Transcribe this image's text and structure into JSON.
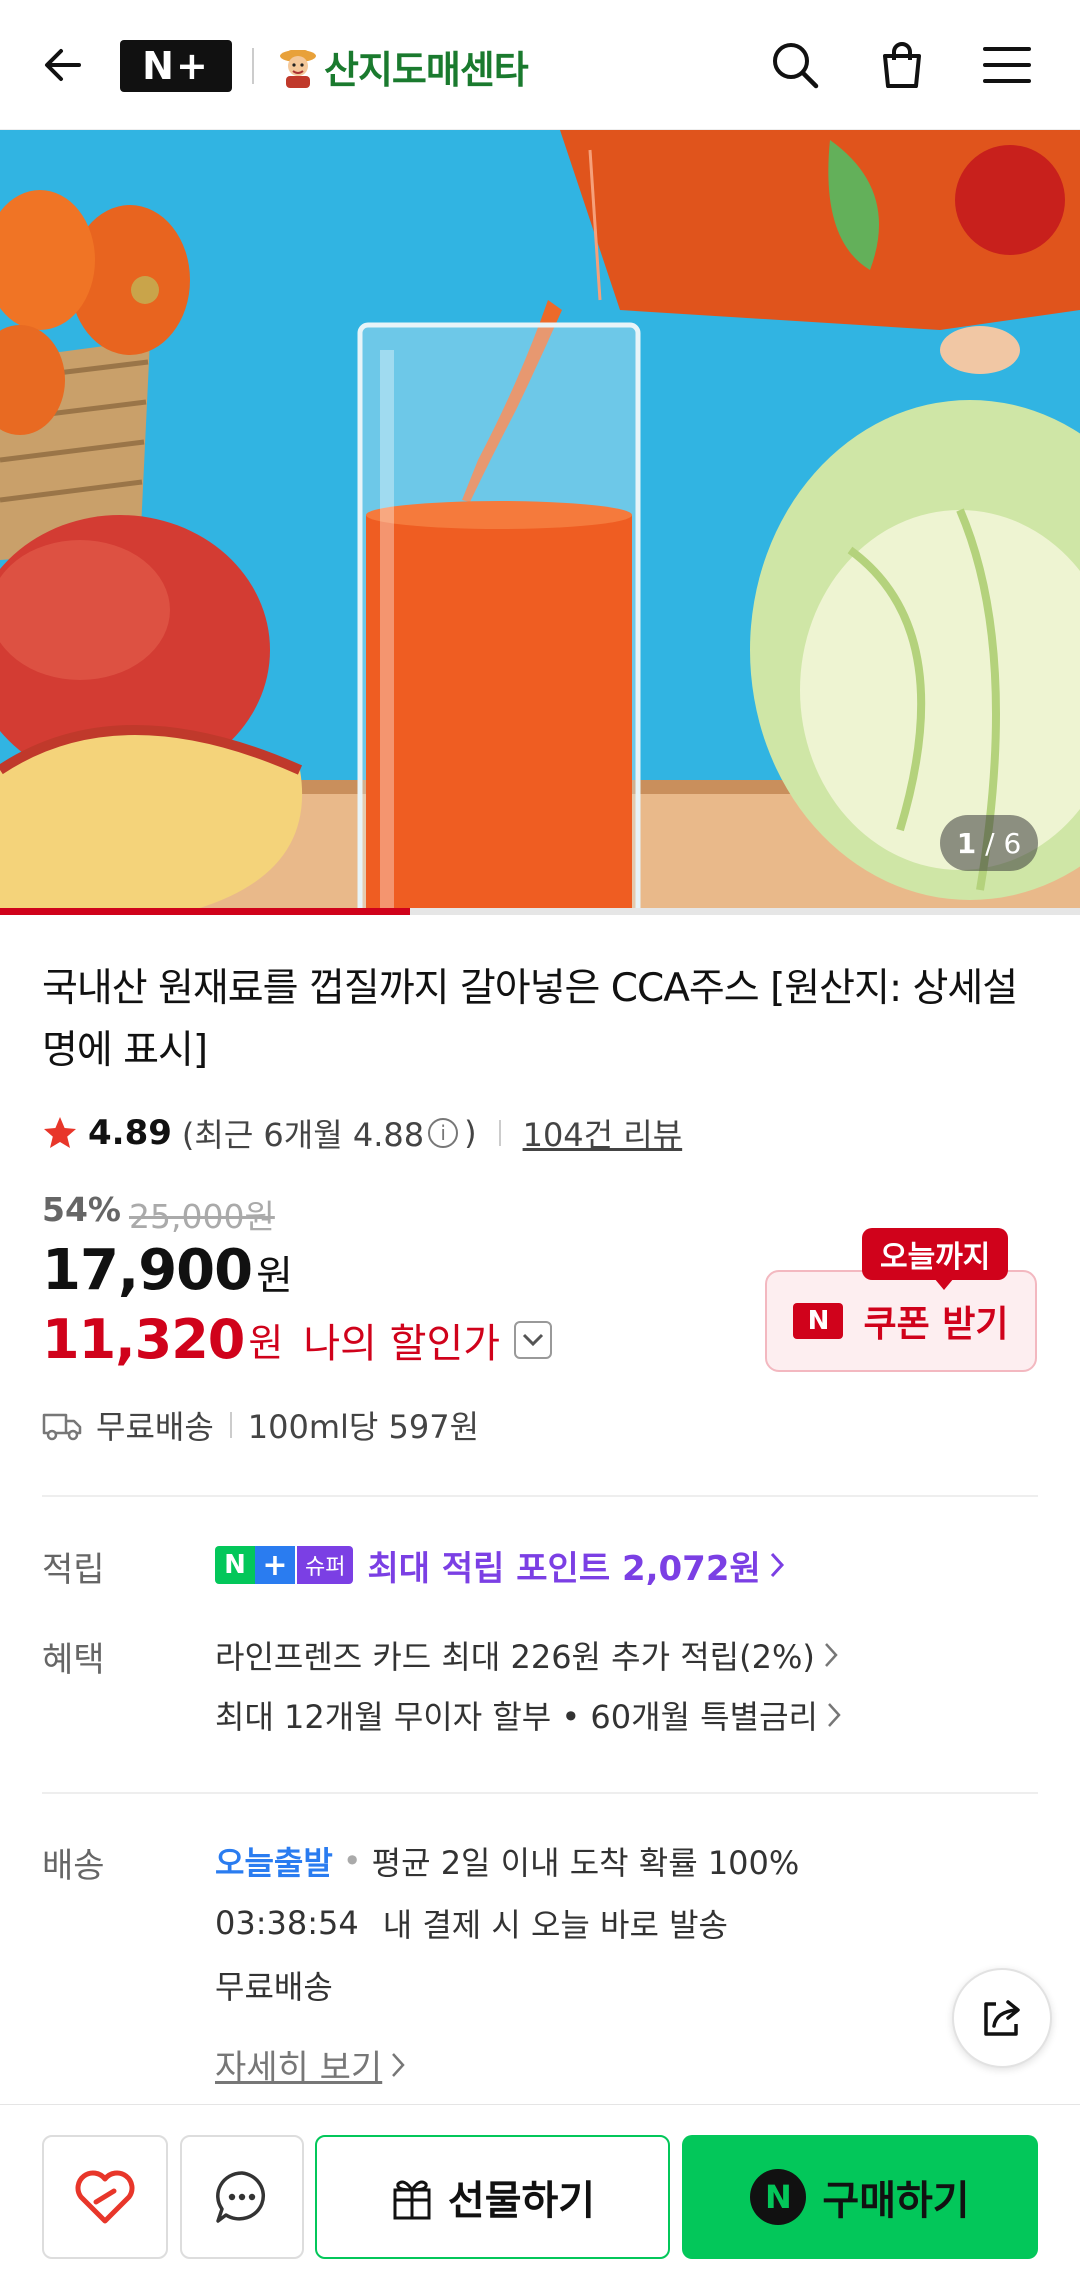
{
  "header": {
    "logo_text": "N+",
    "brand_name": "산지도매센타"
  },
  "hero": {
    "counter_current": "1",
    "counter_total": "/ 6",
    "progress_fraction": 0.38
  },
  "product": {
    "title": "국내산 원재료를 껍질까지 갈아넣은 CCA주스 [원산지: 상세설명에 표시]",
    "rating": "4.89",
    "recent_rating": "(최근 6개월 4.88",
    "recent_rating_close": ")",
    "reviews": "104건 리뷰",
    "discount_rate": "54%",
    "original_price": "25,000원",
    "price": "17,900",
    "price_unit": "원",
    "my_price": "11,320",
    "my_price_unit": "원",
    "my_price_label": "나의 할인가",
    "coupon_badge": "오늘까지",
    "coupon_label": "쿠폰 받기",
    "coupon_n": "N",
    "shipping_free": "무료배송",
    "unit_price": "100ml당 597원"
  },
  "points": {
    "label": "적립",
    "badge_n": "N",
    "badge_plus": "+",
    "badge_super": "슈퍼",
    "text": "최대 적립 포인트 2,072원"
  },
  "benefits": {
    "label": "혜택",
    "items": [
      "라인프렌즈 카드 최대 226원 추가 적립(2%)",
      "최대 12개월 무이자 할부 • 60개월 특별금리"
    ]
  },
  "delivery": {
    "label": "배송",
    "today_ship": "오늘출발",
    "arrival": "평균 2일 이내 도착 확률 100%",
    "timer": "03:38:54",
    "timer_text": "내 결제 시 오늘 바로 발송",
    "free": "무료배송",
    "detail_link": "자세히 보기"
  },
  "bottom_bar": {
    "gift_label": "선물하기",
    "buy_label": "구매하기",
    "buy_n": "N"
  },
  "colors": {
    "accent_red": "#d0021b",
    "naver_green": "#03c75a",
    "point_purple": "#7b3fe4",
    "link_blue": "#2a7cf0"
  }
}
